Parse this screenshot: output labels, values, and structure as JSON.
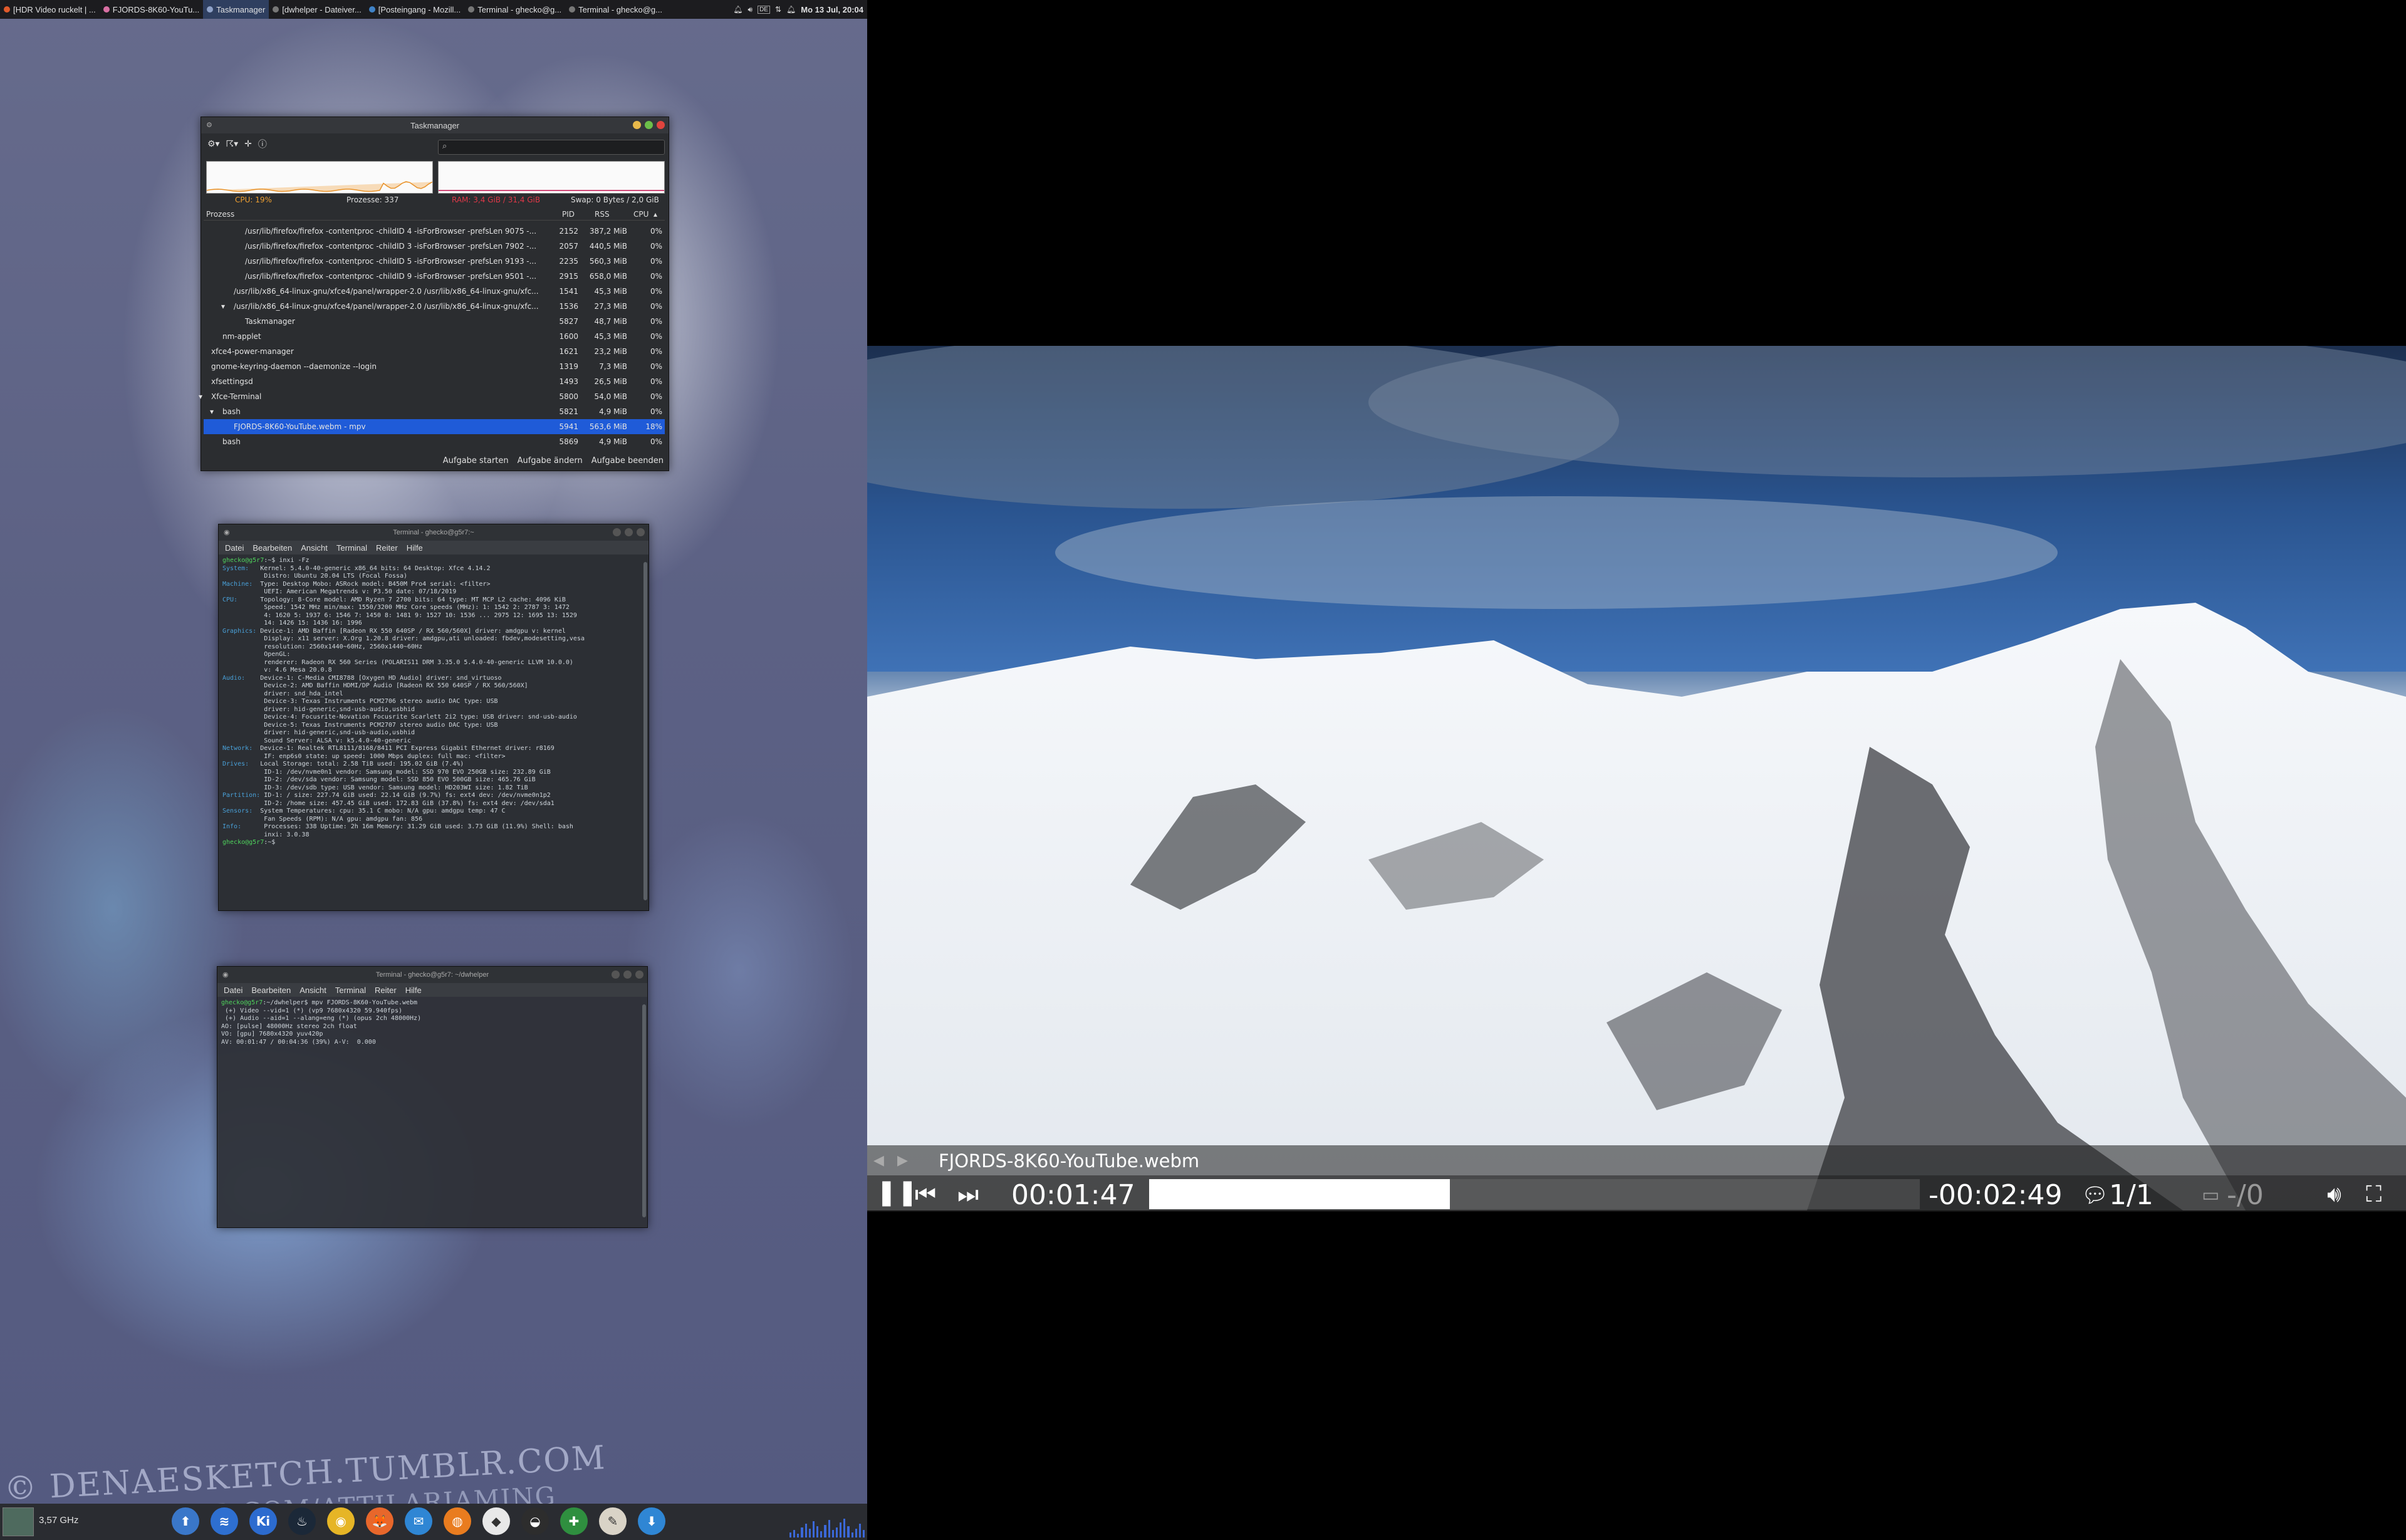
{
  "top_panel": {
    "tasks": [
      {
        "label": "[HDR Video ruckelt | ...",
        "dot": "#e05a2b",
        "active": false
      },
      {
        "label": "FJORDS-8K60-YouTu...",
        "dot": "#d86fa3",
        "active": false
      },
      {
        "label": "Taskmanager",
        "dot": "#8fa2c8",
        "active": true
      },
      {
        "label": "[dwhelper - Dateiver...",
        "dot": "#777777",
        "active": false
      },
      {
        "label": "[Posteingang - Mozill...",
        "dot": "#3f82c7",
        "active": false
      },
      {
        "label": "Terminal - ghecko@g...",
        "dot": "#777777",
        "active": false
      },
      {
        "label": "Terminal - ghecko@g...",
        "dot": "#777777",
        "active": false
      }
    ],
    "keyboard_layout": "DE",
    "clock": "Mo 13 Jul, 20:04"
  },
  "taskmanager": {
    "title": "Taskmanager",
    "search_placeholder": "",
    "stats": {
      "cpu": "CPU: 19%",
      "processes": "Prozesse: 337",
      "memory": "RAM: 3,4 GiB / 31,4 GiB",
      "swap": "Swap: 0 Bytes / 2,0 GiB"
    },
    "columns": {
      "process": "Prozess",
      "pid": "PID",
      "rss": "RSS",
      "cpu": "CPU"
    },
    "cpu_graph_level": 0.3,
    "rows": [
      {
        "name": "/usr/lib/firefox/firefox -contentproc -childID 4 -isForBrowser -prefsLen 9075 -...",
        "pid": "2152",
        "rss": "387,2 MiB",
        "cpu": "0%",
        "indent": 3,
        "expander": ""
      },
      {
        "name": "/usr/lib/firefox/firefox -contentproc -childID 3 -isForBrowser -prefsLen 7902 -...",
        "pid": "2057",
        "rss": "440,5 MiB",
        "cpu": "0%",
        "indent": 3,
        "expander": ""
      },
      {
        "name": "/usr/lib/firefox/firefox -contentproc -childID 5 -isForBrowser -prefsLen 9193 -...",
        "pid": "2235",
        "rss": "560,3 MiB",
        "cpu": "0%",
        "indent": 3,
        "expander": ""
      },
      {
        "name": "/usr/lib/firefox/firefox -contentproc -childID 9 -isForBrowser -prefsLen 9501 -...",
        "pid": "2915",
        "rss": "658,0 MiB",
        "cpu": "0%",
        "indent": 3,
        "expander": ""
      },
      {
        "name": "/usr/lib/x86_64-linux-gnu/xfce4/panel/wrapper-2.0 /usr/lib/x86_64-linux-gnu/xfc...",
        "pid": "1541",
        "rss": "45,3 MiB",
        "cpu": "0%",
        "indent": 2,
        "expander": ""
      },
      {
        "name": "/usr/lib/x86_64-linux-gnu/xfce4/panel/wrapper-2.0 /usr/lib/x86_64-linux-gnu/xfc...",
        "pid": "1536",
        "rss": "27,3 MiB",
        "cpu": "0%",
        "indent": 2,
        "expander": "▾"
      },
      {
        "name": "Taskmanager",
        "pid": "5827",
        "rss": "48,7 MiB",
        "cpu": "0%",
        "indent": 3,
        "expander": ""
      },
      {
        "name": "nm-applet",
        "pid": "1600",
        "rss": "45,3 MiB",
        "cpu": "0%",
        "indent": 1,
        "expander": ""
      },
      {
        "name": "xfce4-power-manager",
        "pid": "1621",
        "rss": "23,2 MiB",
        "cpu": "0%",
        "indent": 0,
        "expander": ""
      },
      {
        "name": "gnome-keyring-daemon --daemonize --login",
        "pid": "1319",
        "rss": "7,3 MiB",
        "cpu": "0%",
        "indent": 0,
        "expander": ""
      },
      {
        "name": "xfsettingsd",
        "pid": "1493",
        "rss": "26,5 MiB",
        "cpu": "0%",
        "indent": 0,
        "expander": ""
      },
      {
        "name": "Xfce-Terminal",
        "pid": "5800",
        "rss": "54,0 MiB",
        "cpu": "0%",
        "indent": 0,
        "expander": "▾"
      },
      {
        "name": "bash",
        "pid": "5821",
        "rss": "4,9 MiB",
        "cpu": "0%",
        "indent": 1,
        "expander": "▾"
      },
      {
        "name": "FJORDS-8K60-YouTube.webm - mpv",
        "pid": "5941",
        "rss": "563,6 MiB",
        "cpu": "18%",
        "indent": 2,
        "expander": "",
        "selected": true
      },
      {
        "name": "bash",
        "pid": "5869",
        "rss": "4,9 MiB",
        "cpu": "0%",
        "indent": 1,
        "expander": ""
      }
    ],
    "buttons": {
      "start": "Aufgabe starten",
      "change": "Aufgabe ändern",
      "end": "Aufgabe beenden"
    }
  },
  "terminal_menu": [
    "Datei",
    "Bearbeiten",
    "Ansicht",
    "Terminal",
    "Reiter",
    "Hilfe"
  ],
  "terminal1": {
    "title": "Terminal - ghecko@g5r7:~",
    "lines": [
      {
        "k": "ghecko@g5r7",
        "t": ":~$ inxi -Fz"
      },
      {
        "k": "System:",
        "t": "   Kernel: 5.4.0-40-generic x86_64 bits: 64 Desktop: Xfce 4.14.2"
      },
      {
        "k": "",
        "t": "           Distro: Ubuntu 20.04 LTS (Focal Fossa)"
      },
      {
        "k": "Machine:",
        "t": "  Type: Desktop Mobo: ASRock model: B450M Pro4 serial: <filter>"
      },
      {
        "k": "",
        "t": "           UEFI: American Megatrends v: P3.50 date: 07/18/2019"
      },
      {
        "k": "CPU:",
        "t": "      Topology: 8-Core model: AMD Ryzen 7 2700 bits: 64 type: MT MCP L2 cache: 4096 KiB"
      },
      {
        "k": "",
        "t": "           Speed: 1542 MHz min/max: 1550/3200 MHz Core speeds (MHz): 1: 1542 2: 2787 3: 1472"
      },
      {
        "k": "",
        "t": "           4: 1620 5: 1937 6: 1546 7: 1450 8: 1481 9: 1527 10: 1536 ... 2975 12: 1695 13: 1529"
      },
      {
        "k": "",
        "t": "           14: 1426 15: 1436 16: 1996"
      },
      {
        "k": "Graphics:",
        "t": " Device-1: AMD Baffin [Radeon RX 550 640SP / RX 560/560X] driver: amdgpu v: kernel"
      },
      {
        "k": "",
        "t": "           Display: x11 server: X.Org 1.20.8 driver: amdgpu,ati unloaded: fbdev,modesetting,vesa"
      },
      {
        "k": "",
        "t": "           resolution: 2560x1440~60Hz, 2560x1440~60Hz"
      },
      {
        "k": "",
        "t": "           OpenGL:"
      },
      {
        "k": "",
        "t": "           renderer: Radeon RX 560 Series (POLARIS11 DRM 3.35.0 5.4.0-40-generic LLVM 10.0.0)"
      },
      {
        "k": "",
        "t": "           v: 4.6 Mesa 20.0.8"
      },
      {
        "k": "Audio:",
        "t": "    Device-1: C-Media CMI8788 [Oxygen HD Audio] driver: snd_virtuoso"
      },
      {
        "k": "",
        "t": "           Device-2: AMD Baffin HDMI/DP Audio [Radeon RX 550 640SP / RX 560/560X]"
      },
      {
        "k": "",
        "t": "           driver: snd_hda_intel"
      },
      {
        "k": "",
        "t": "           Device-3: Texas Instruments PCM2706 stereo audio DAC type: USB"
      },
      {
        "k": "",
        "t": "           driver: hid-generic,snd-usb-audio,usbhid"
      },
      {
        "k": "",
        "t": "           Device-4: Focusrite-Novation Focusrite Scarlett 2i2 type: USB driver: snd-usb-audio"
      },
      {
        "k": "",
        "t": "           Device-5: Texas Instruments PCM2707 stereo audio DAC type: USB"
      },
      {
        "k": "",
        "t": "           driver: hid-generic,snd-usb-audio,usbhid"
      },
      {
        "k": "",
        "t": "           Sound Server: ALSA v: k5.4.0-40-generic"
      },
      {
        "k": "Network:",
        "t": "  Device-1: Realtek RTL8111/8168/8411 PCI Express Gigabit Ethernet driver: r8169"
      },
      {
        "k": "",
        "t": "           IF: enp6s0 state: up speed: 1000 Mbps duplex: full mac: <filter>"
      },
      {
        "k": "Drives:",
        "t": "   Local Storage: total: 2.58 TiB used: 195.02 GiB (7.4%)"
      },
      {
        "k": "",
        "t": "           ID-1: /dev/nvme0n1 vendor: Samsung model: SSD 970 EVO 250GB size: 232.89 GiB"
      },
      {
        "k": "",
        "t": "           ID-2: /dev/sda vendor: Samsung model: SSD 850 EVO 500GB size: 465.76 GiB"
      },
      {
        "k": "",
        "t": "           ID-3: /dev/sdb type: USB vendor: Samsung model: HD203WI size: 1.82 TiB"
      },
      {
        "k": "Partition:",
        "t": " ID-1: / size: 227.74 GiB used: 22.14 GiB (9.7%) fs: ext4 dev: /dev/nvme0n1p2"
      },
      {
        "k": "",
        "t": "           ID-2: /home size: 457.45 GiB used: 172.83 GiB (37.8%) fs: ext4 dev: /dev/sda1"
      },
      {
        "k": "Sensors:",
        "t": "  System Temperatures: cpu: 35.1 C mobo: N/A gpu: amdgpu temp: 47 C"
      },
      {
        "k": "",
        "t": "           Fan Speeds (RPM): N/A gpu: amdgpu fan: 856"
      },
      {
        "k": "Info:",
        "t": "      Processes: 338 Uptime: 2h 16m Memory: 31.29 GiB used: 3.73 GiB (11.9%) Shell: bash"
      },
      {
        "k": "",
        "t": "           inxi: 3.0.38"
      },
      {
        "k": "ghecko@g5r7",
        "t": ":~$ "
      }
    ]
  },
  "terminal2": {
    "title": "Terminal - ghecko@g5r7: ~/dwhelper",
    "lines": [
      {
        "k": "ghecko@g5r7",
        "t": ":~/dwhelper$ mpv FJORDS-8K60-YouTube.webm"
      },
      {
        "k": "",
        "t": " (+) Video --vid=1 (*) (vp9 7680x4320 59.940fps)"
      },
      {
        "k": "",
        "t": " (+) Audio --aid=1 --alang=eng (*) (opus 2ch 48000Hz)"
      },
      {
        "k": "",
        "t": "AO: [pulse] 48000Hz stereo 2ch float"
      },
      {
        "k": "",
        "t": "VO: [gpu] 7680x4320 yuv420p"
      },
      {
        "k": "",
        "t": "AV: 00:01:47 / 00:04:36 (39%) A-V:  0.000"
      }
    ]
  },
  "mpv": {
    "title": "FJORDS-8K60-YouTube.webm",
    "elapsed": "00:01:47",
    "remaining": "-00:02:49",
    "chapter": "1/1",
    "subtitles": "-/0",
    "progress": 0.39
  },
  "bottom_panel": {
    "cpu_freq": "3,57 GHz",
    "dock": [
      {
        "name": "update-icon",
        "glyph": "⬆",
        "bg": "#3a77c9"
      },
      {
        "name": "audio-wave-icon",
        "glyph": "≋",
        "bg": "#2e6fd0"
      },
      {
        "name": "ki-icon",
        "glyph": "Ki",
        "bg": "#2c6bcf"
      },
      {
        "name": "steam-icon",
        "glyph": "♨",
        "bg": "#1b2838"
      },
      {
        "name": "disk-icon",
        "glyph": "◉",
        "bg": "#e6b526"
      },
      {
        "name": "firefox-icon",
        "glyph": "🦊",
        "bg": "#e8672b"
      },
      {
        "name": "mail-icon",
        "glyph": "✉",
        "bg": "#2f86d4"
      },
      {
        "name": "blender-icon",
        "glyph": "◍",
        "bg": "#e97c1f"
      },
      {
        "name": "inkscape-icon",
        "glyph": "◆",
        "bg": "#e8e8e8"
      },
      {
        "name": "obs-icon",
        "glyph": "◒",
        "bg": "#2d2d2d"
      },
      {
        "name": "network-icon",
        "glyph": "✚",
        "bg": "#2f8f3f"
      },
      {
        "name": "pen-icon",
        "glyph": "✎",
        "bg": "#d9d3c7"
      },
      {
        "name": "download-icon",
        "glyph": "⬇",
        "bg": "#2f86d4"
      }
    ]
  },
  "watermark": {
    "line1": "© DENAESKETCH.TUMBLR.COM",
    "line2": "TWITTER.COM/ATTILARIAMING"
  }
}
